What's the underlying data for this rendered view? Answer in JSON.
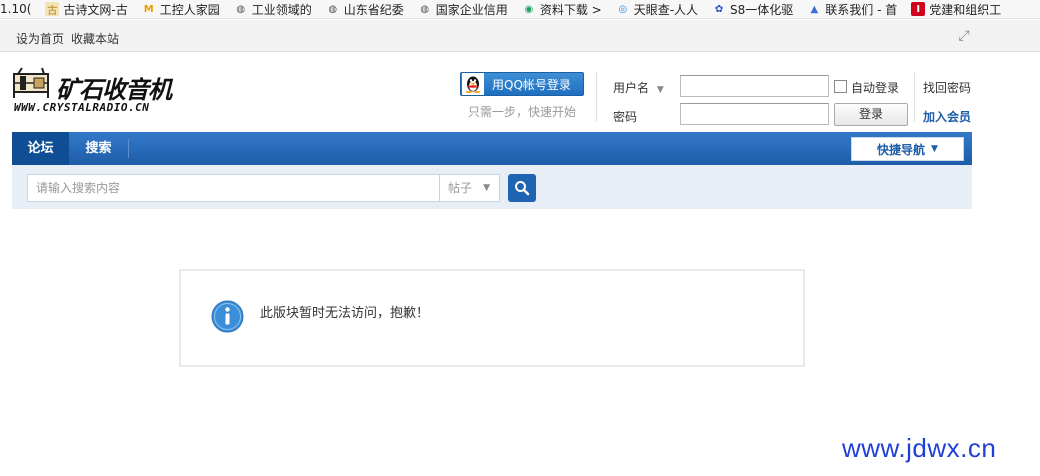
{
  "bookmarks": [
    {
      "label": "1.10(",
      "icon": "blank",
      "color": "#ffffff"
    },
    {
      "label": "古诗文网-古",
      "icon": "gu-icon",
      "color": "#c8a24a"
    },
    {
      "label": "工控人家园",
      "icon": "m-icon",
      "color": "#e8a000"
    },
    {
      "label": "工业领域的",
      "icon": "globe-icon",
      "color": "#555555"
    },
    {
      "label": "山东省纪委",
      "icon": "globe-icon",
      "color": "#555555"
    },
    {
      "label": "国家企业信用",
      "icon": "globe-icon",
      "color": "#555555"
    },
    {
      "label": "资料下载 > ",
      "icon": "green-circle-icon",
      "color": "#1aa260"
    },
    {
      "label": "天眼查-人人",
      "icon": "tianyan-icon",
      "color": "#1e88e5"
    },
    {
      "label": "S8一体化驱",
      "icon": "paw-icon",
      "color": "#2b4bcc"
    },
    {
      "label": "联系我们 - 首",
      "icon": "triangle-icon",
      "color": "#3b6fd4"
    },
    {
      "label": "党建和组织工",
      "icon": "red-i-icon",
      "color": "#d0021b"
    }
  ],
  "topbar": {
    "set_home": "设为首页",
    "bookmark": "收藏本站"
  },
  "logo": {
    "title": "矿石收音机",
    "url_text": "WWW.CRYSTALRADIO.CN"
  },
  "qq_login": {
    "label": "用QQ帐号登录",
    "tip": "只需一步，快速开始"
  },
  "login": {
    "username_label": "用户名",
    "password_label": "密码",
    "auto_login": "自动登录",
    "login_button": "登录",
    "find_password": "找回密码",
    "register": "加入会员"
  },
  "nav": {
    "forum": "论坛",
    "search": "搜索",
    "quick_nav": "快捷导航"
  },
  "search": {
    "placeholder": "请输入搜索内容",
    "type": "帖子"
  },
  "message": "此版块暂时无法访问，抱歉！",
  "watermark": "www.jdwx.cn",
  "colors": {
    "nav_blue": "#1e5da8",
    "link_blue": "#1e5da8",
    "watermark": "#1f3fd6"
  }
}
